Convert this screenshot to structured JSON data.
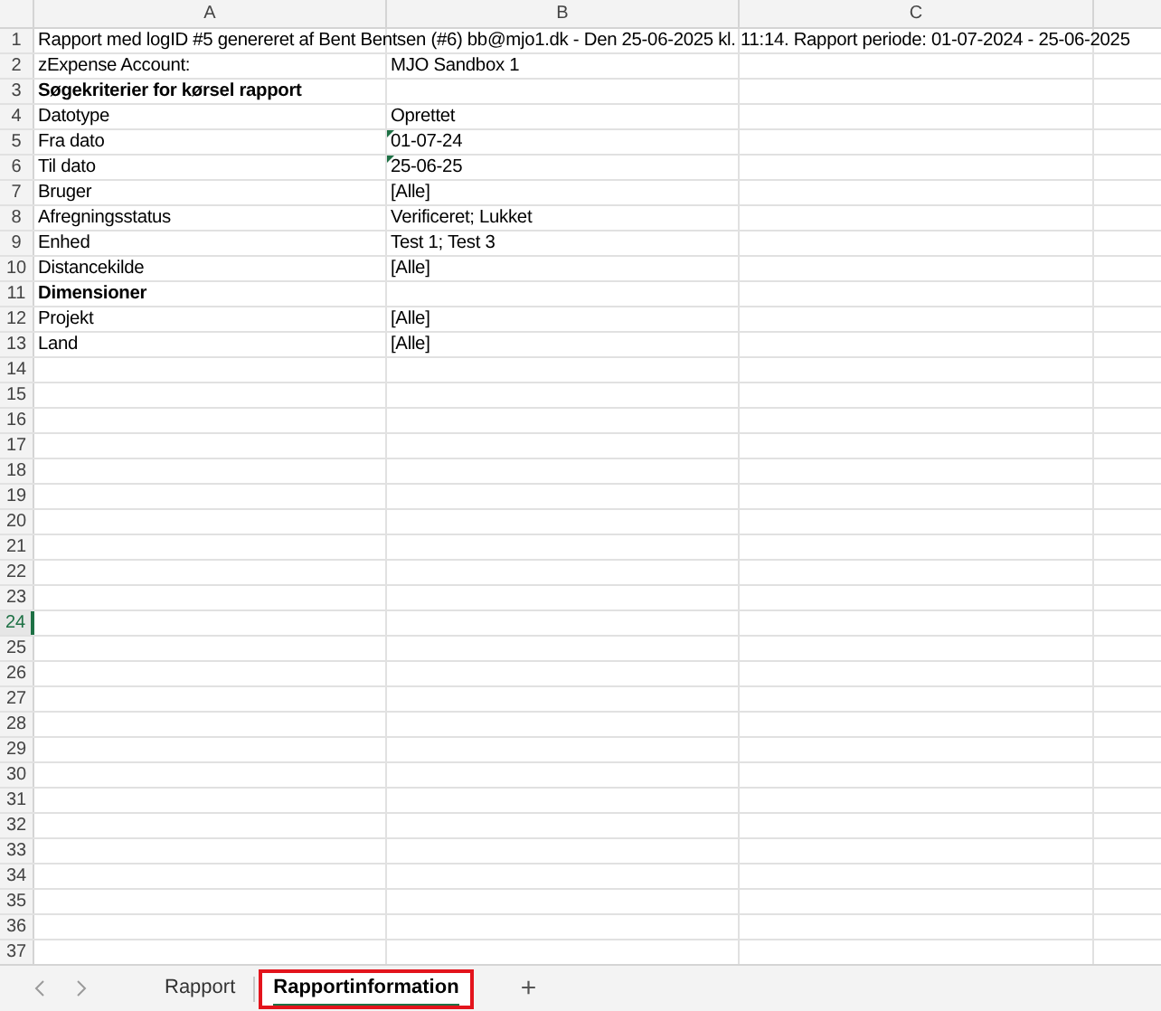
{
  "columns": [
    "A",
    "B",
    "C"
  ],
  "rows": [
    {
      "number": "1",
      "selected": false,
      "bold": false,
      "cells": [
        "Rapport med logID #5 genereret af Bent Bentsen (#6) bb@mjo1.dk - Den 25-06-2025 kl. 11:14. Rapport periode: 01-07-2024 - 25-06-2025",
        ""
      ]
    },
    {
      "number": "2",
      "selected": false,
      "bold": false,
      "cells": [
        "zExpense Account:",
        "MJO Sandbox 1"
      ]
    },
    {
      "number": "3",
      "selected": false,
      "bold": true,
      "cells": [
        "Søgekriterier for kørsel rapport",
        ""
      ]
    },
    {
      "number": "4",
      "selected": false,
      "bold": false,
      "cells": [
        "Datotype",
        "Oprettet"
      ]
    },
    {
      "number": "5",
      "selected": false,
      "bold": false,
      "cells": [
        "Fra dato",
        "01-07-24"
      ],
      "flagged": true
    },
    {
      "number": "6",
      "selected": false,
      "bold": false,
      "cells": [
        "Til dato",
        "25-06-25"
      ],
      "flagged": true
    },
    {
      "number": "7",
      "selected": false,
      "bold": false,
      "cells": [
        "Bruger",
        "[Alle]"
      ]
    },
    {
      "number": "8",
      "selected": false,
      "bold": false,
      "cells": [
        "Afregningsstatus",
        "Verificeret; Lukket"
      ]
    },
    {
      "number": "9",
      "selected": false,
      "bold": false,
      "cells": [
        "Enhed",
        "Test 1; Test 3"
      ]
    },
    {
      "number": "10",
      "selected": false,
      "bold": false,
      "cells": [
        "Distancekilde",
        "[Alle]"
      ]
    },
    {
      "number": "11",
      "selected": false,
      "bold": true,
      "cells": [
        "Dimensioner",
        ""
      ]
    },
    {
      "number": "12",
      "selected": false,
      "bold": false,
      "cells": [
        "Projekt",
        "[Alle]"
      ]
    },
    {
      "number": "13",
      "selected": false,
      "bold": false,
      "cells": [
        "Land",
        "[Alle]"
      ]
    },
    {
      "number": "14",
      "selected": false
    },
    {
      "number": "15",
      "selected": false
    },
    {
      "number": "16",
      "selected": false
    },
    {
      "number": "17",
      "selected": false
    },
    {
      "number": "18",
      "selected": false
    },
    {
      "number": "19",
      "selected": false
    },
    {
      "number": "20",
      "selected": false
    },
    {
      "number": "21",
      "selected": false
    },
    {
      "number": "22",
      "selected": false
    },
    {
      "number": "23",
      "selected": false
    },
    {
      "number": "24",
      "selected": true
    },
    {
      "number": "25",
      "selected": false
    },
    {
      "number": "26",
      "selected": false
    },
    {
      "number": "27",
      "selected": false
    },
    {
      "number": "28",
      "selected": false
    },
    {
      "number": "29",
      "selected": false
    },
    {
      "number": "30",
      "selected": false
    },
    {
      "number": "31",
      "selected": false
    },
    {
      "number": "32",
      "selected": false
    },
    {
      "number": "33",
      "selected": false
    },
    {
      "number": "34",
      "selected": false
    },
    {
      "number": "35",
      "selected": false
    },
    {
      "number": "36",
      "selected": false
    },
    {
      "number": "37",
      "selected": false
    }
  ],
  "sheet_tabs": [
    {
      "label": "Rapport",
      "selected": false,
      "highlighted": false
    },
    {
      "label": "Rapportinformation",
      "selected": true,
      "highlighted": true
    }
  ],
  "add_sheet": "+"
}
